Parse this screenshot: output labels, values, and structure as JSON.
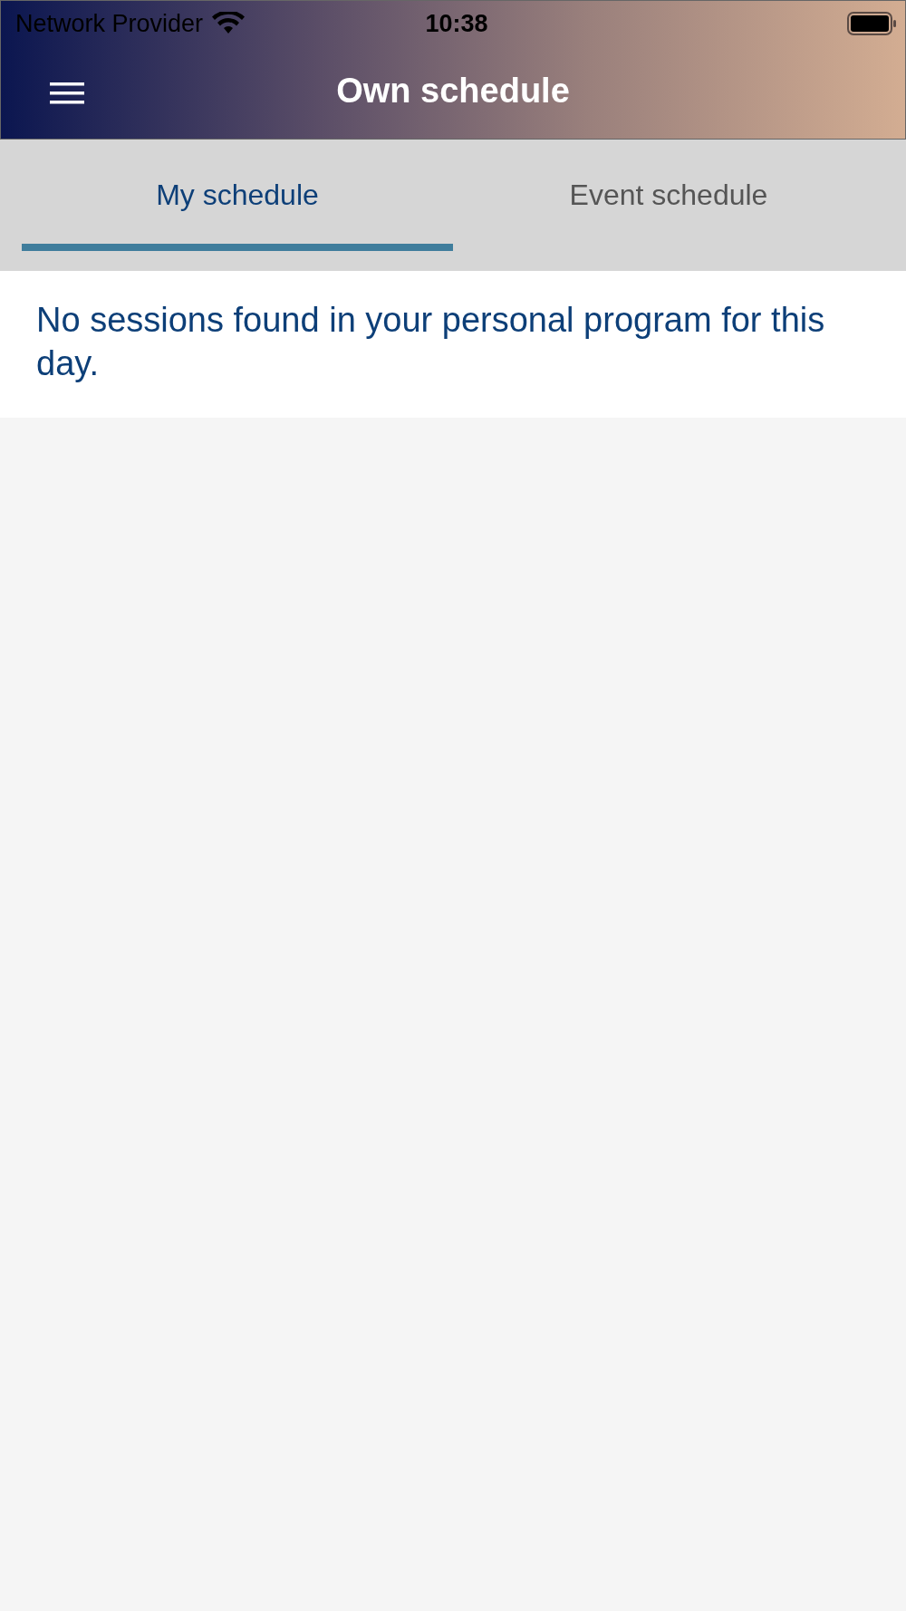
{
  "status_bar": {
    "carrier": "Network Provider",
    "time": "10:38"
  },
  "header": {
    "title": "Own schedule"
  },
  "tabs": [
    {
      "label": "My schedule",
      "selected": true
    },
    {
      "label": "Event schedule",
      "selected": false
    }
  ],
  "message": "No sessions found in your personal program for this day."
}
